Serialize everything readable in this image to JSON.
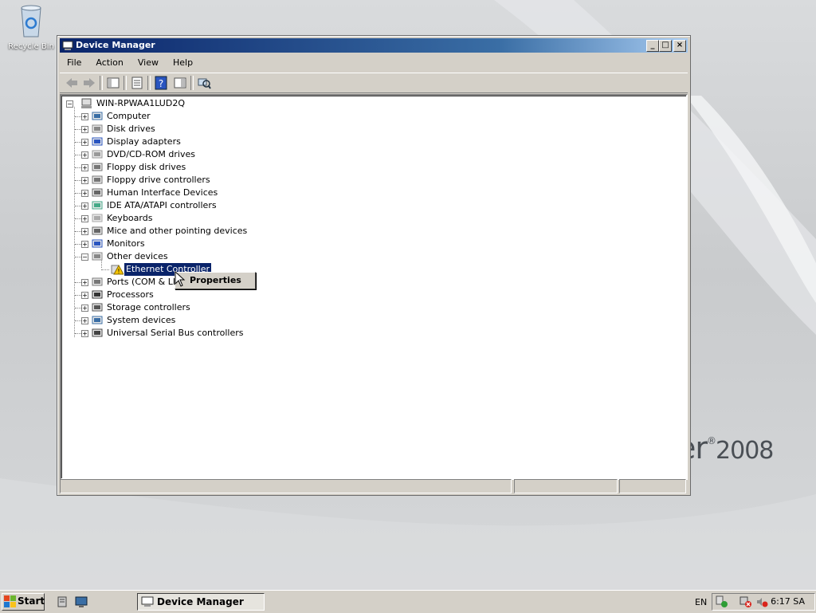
{
  "desktop": {
    "recycle_bin_label": "Recycle Bin",
    "brand_text": "er",
    "brand_mark": "®",
    "brand_year": "2008"
  },
  "window": {
    "title": "Device Manager",
    "menu": [
      "File",
      "Action",
      "View",
      "Help"
    ]
  },
  "tree": {
    "root": "WIN-RPWAA1LUD2Q",
    "categories": [
      "Computer",
      "Disk drives",
      "Display adapters",
      "DVD/CD-ROM drives",
      "Floppy disk drives",
      "Floppy drive controllers",
      "Human Interface Devices",
      "IDE ATA/ATAPI controllers",
      "Keyboards",
      "Mice and other pointing devices",
      "Monitors",
      "Other devices",
      "Ports (COM & LPT)",
      "Processors",
      "Storage controllers",
      "System devices",
      "Universal Serial Bus controllers"
    ],
    "child_of_other_devices": "Ethernet Controller"
  },
  "context_menu": {
    "item": "Properties"
  },
  "taskbar": {
    "start_label": "Start",
    "task_label": "Device Manager",
    "language": "EN",
    "clock": "6:17 SA"
  }
}
